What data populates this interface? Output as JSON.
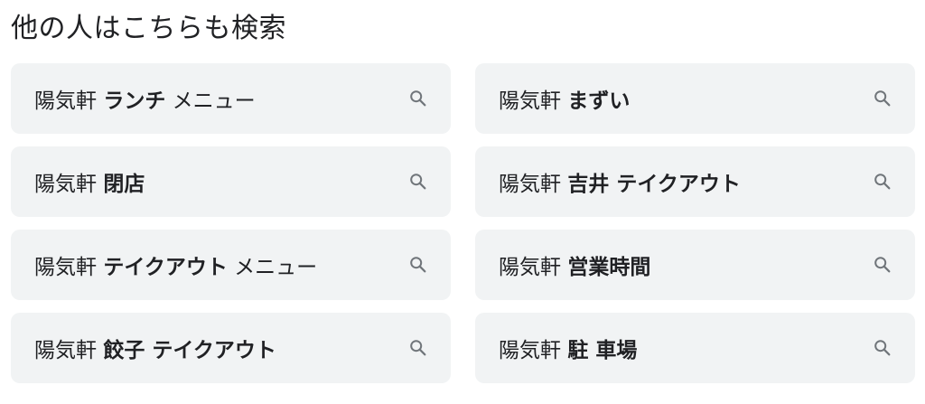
{
  "heading": "他の人はこちらも検索",
  "suggestions": [
    {
      "base": "陽気軒",
      "bold": "ランチ",
      "rest": "メニュー"
    },
    {
      "base": "陽気軒",
      "bold": "まずい",
      "rest": ""
    },
    {
      "base": "陽気軒",
      "bold": "閉店",
      "rest": ""
    },
    {
      "base": "陽気軒",
      "bold": "吉井 テイクアウト",
      "rest": ""
    },
    {
      "base": "陽気軒",
      "bold": "テイクアウト",
      "rest": "メニュー"
    },
    {
      "base": "陽気軒",
      "bold": "営業時間",
      "rest": ""
    },
    {
      "base": "陽気軒",
      "bold": "餃子 テイクアウト",
      "rest": ""
    },
    {
      "base": "陽気軒",
      "bold": "駐 車場",
      "rest": ""
    }
  ],
  "icon": "search-icon",
  "colors": {
    "chip_bg": "#f1f3f4",
    "text": "#202124",
    "icon": "#70757a"
  }
}
